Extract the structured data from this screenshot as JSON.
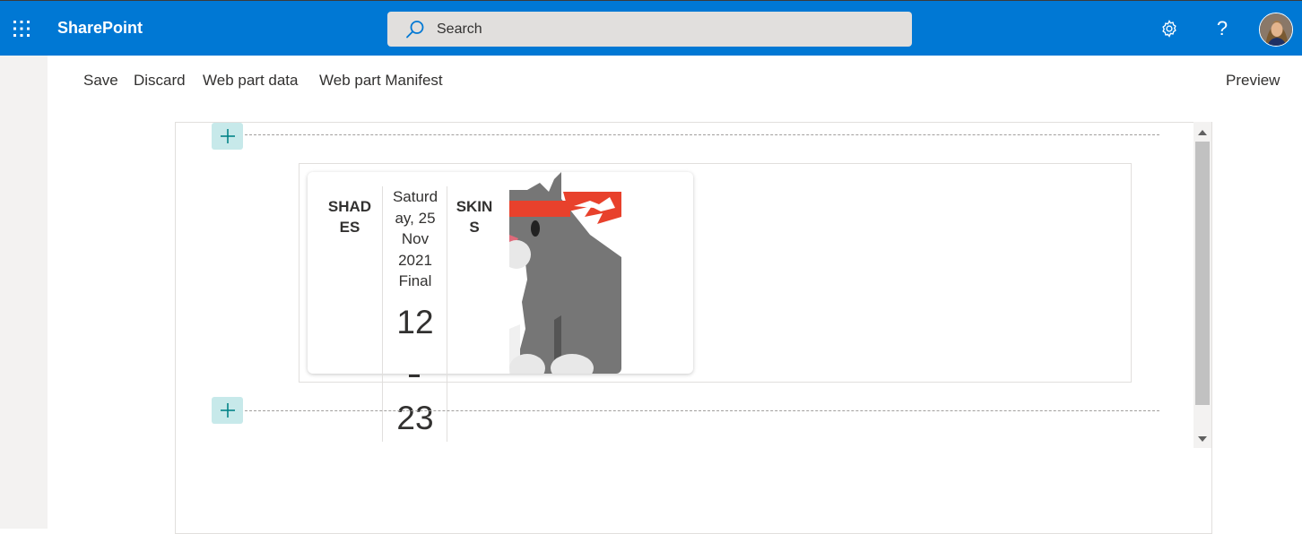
{
  "header": {
    "app_name": "SharePoint",
    "search_placeholder": "Search",
    "help_label": "?"
  },
  "commandbar": {
    "save": "Save",
    "discard": "Discard",
    "web_part_data": "Web part data",
    "web_part_manifest": "Web part Manifest",
    "preview": "Preview"
  },
  "scorecard": {
    "home_team": "SHAD\nES",
    "date_lines": [
      "Saturd",
      "ay, 25",
      "Nov",
      "2021",
      "Final"
    ],
    "home_score": "12",
    "away_score": "23",
    "away_team": "SKIN\nS"
  },
  "colors": {
    "suitebar": "#0078d4",
    "add_button": "#c7e9ea",
    "headband": "#e8412c",
    "cat_gray": "#767676"
  },
  "icons": [
    "waffle-icon",
    "search-icon",
    "gear-icon",
    "help-icon",
    "plus-icon",
    "chevron-up-icon",
    "chevron-down-icon"
  ]
}
